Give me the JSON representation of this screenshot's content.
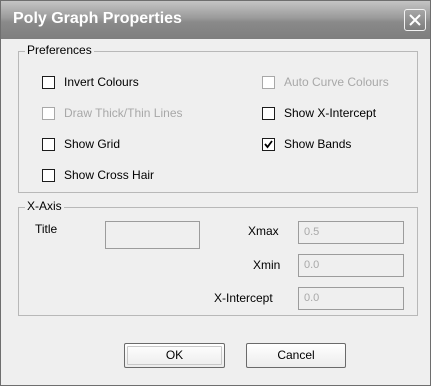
{
  "window": {
    "title": "Poly Graph Properties"
  },
  "preferences": {
    "legend": "Preferences",
    "options": [
      {
        "label": "Invert Colours",
        "checked": false,
        "enabled": true
      },
      {
        "label": "Auto Curve Colours",
        "checked": false,
        "enabled": false
      },
      {
        "label": "Draw Thick/Thin Lines",
        "checked": false,
        "enabled": false
      },
      {
        "label": "Show X-Intercept",
        "checked": false,
        "enabled": true
      },
      {
        "label": "Show Grid",
        "checked": false,
        "enabled": true
      },
      {
        "label": "Show Bands",
        "checked": true,
        "enabled": true
      },
      {
        "label": "Show Cross Hair",
        "checked": false,
        "enabled": true
      }
    ]
  },
  "xaxis": {
    "legend": "X-Axis",
    "title_label": "Title",
    "title_value": "",
    "xmax_label": "Xmax",
    "xmax_value": "0.5",
    "xmin_label": "Xmin",
    "xmin_value": "0.0",
    "xintercept_label": "X-Intercept",
    "xintercept_value": "0.0"
  },
  "buttons": {
    "ok": "OK",
    "cancel": "Cancel"
  },
  "colors": {
    "titlebar": "#8a8a8a",
    "dialog_bg": "#efefef",
    "disabled_text": "#a8a8a8"
  },
  "icons": {
    "close": "close-icon",
    "check": "check-icon"
  }
}
